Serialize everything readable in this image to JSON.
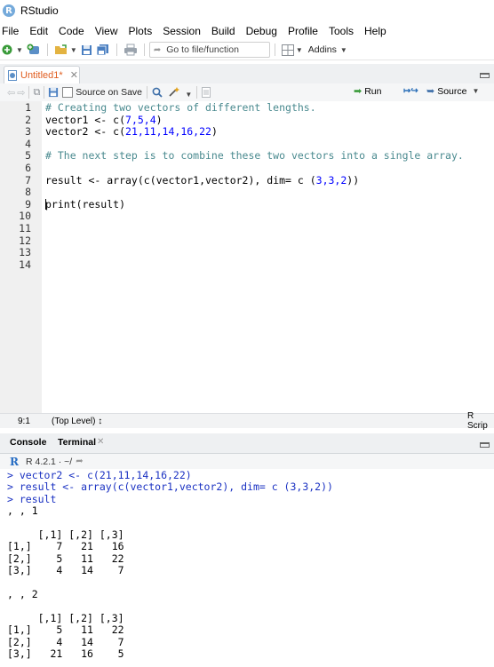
{
  "app": {
    "title": "RStudio",
    "logo_letter": "R"
  },
  "menu": [
    "File",
    "Edit",
    "Code",
    "View",
    "Plots",
    "Session",
    "Build",
    "Debug",
    "Profile",
    "Tools",
    "Help"
  ],
  "main_toolbar": {
    "goto_placeholder": "Go to file/function",
    "addins_label": "Addins"
  },
  "editor": {
    "tab_label": "Untitled1*",
    "toolbar": {
      "source_on_save_label": "Source on Save",
      "run_label": "Run",
      "source_label": "Source"
    },
    "line_numbers": [
      "1",
      "2",
      "3",
      "4",
      "5",
      "6",
      "7",
      "8",
      "9",
      "10",
      "11",
      "12",
      "13",
      "14"
    ],
    "code": {
      "l1": "# Creating two vectors of different lengths.",
      "l2a": "vector1 <- c(",
      "l2n": "7,5,4",
      "l2b": ")",
      "l3a": "vector2 <- c(",
      "l3n": "21,11,14,16,22",
      "l3b": ")",
      "l5": "# The next step is to combine these two vectors into a single array.",
      "l7a": "result <- array(c(vector1,vector2), dim= c (",
      "l7n": "3,3,2",
      "l7b": "))",
      "l9": "print(result)"
    },
    "status": {
      "position": "9:1",
      "scope": "(Top Level) ↕",
      "file_type": "R Scrip"
    }
  },
  "console": {
    "tabs": {
      "console": "Console",
      "terminal": "Terminal"
    },
    "r_version": "R 4.2.1 · ~/",
    "lines": [
      {
        "type": "in",
        "text": "> vector2 <- c(21,11,14,16,22)"
      },
      {
        "type": "in",
        "text": "> result <- array(c(vector1,vector2), dim= c (3,3,2))"
      },
      {
        "type": "in",
        "text": "> result"
      },
      {
        "type": "out",
        "text": ", , 1"
      },
      {
        "type": "out",
        "text": ""
      },
      {
        "type": "out",
        "text": "     [,1] [,2] [,3]"
      },
      {
        "type": "out",
        "text": "[1,]    7   21   16"
      },
      {
        "type": "out",
        "text": "[2,]    5   11   22"
      },
      {
        "type": "out",
        "text": "[3,]    4   14    7"
      },
      {
        "type": "out",
        "text": ""
      },
      {
        "type": "out",
        "text": ", , 2"
      },
      {
        "type": "out",
        "text": ""
      },
      {
        "type": "out",
        "text": "     [,1] [,2] [,3]"
      },
      {
        "type": "out",
        "text": "[1,]    5   11   22"
      },
      {
        "type": "out",
        "text": "[2,]    4   14    7"
      },
      {
        "type": "out",
        "text": "[3,]   21   16    5"
      }
    ]
  },
  "colors": {
    "comment": "#4a8a8f",
    "number": "#0000ff",
    "console_input": "#1a31c2",
    "tab_modified": "#e05d1f"
  }
}
